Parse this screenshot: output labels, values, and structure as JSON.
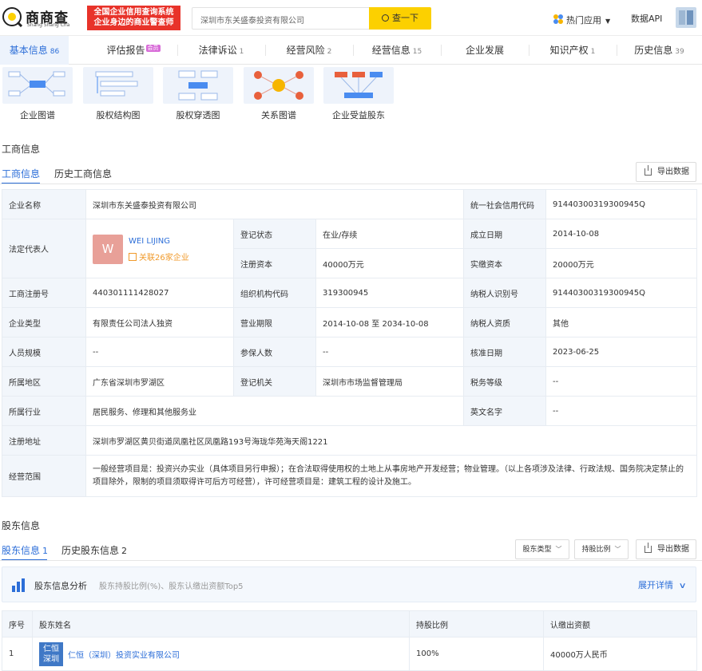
{
  "header": {
    "logo_text": "商商查",
    "logo_sub": "Shang Shang Cha",
    "promo_line1": "全国企业信用查询系统",
    "promo_line2": "企业身边的商业警查师",
    "search_value": "深圳市东关盛泰投资有限公司",
    "search_button": "查一下",
    "hot_apps": "热门应用",
    "data_api": "数据API"
  },
  "tabs": [
    {
      "label": "基本信息",
      "count": "86"
    },
    {
      "label": "评估报告",
      "badge": "会员"
    },
    {
      "label": "法律诉讼",
      "count": "1"
    },
    {
      "label": "经营风险",
      "count": "2"
    },
    {
      "label": "经营信息",
      "count": "15"
    },
    {
      "label": "企业发展",
      "count": ""
    },
    {
      "label": "知识产权",
      "count": "1"
    },
    {
      "label": "历史信息",
      "count": "39"
    }
  ],
  "graphs": [
    "企业图谱",
    "股权结构图",
    "股权穿透图",
    "关系图谱",
    "企业受益股东"
  ],
  "business": {
    "section_title": "工商信息",
    "subtab1": "工商信息",
    "subtab2": "历史工商信息",
    "export": "导出数据",
    "company_name_label": "企业名称",
    "company_name": "深圳市东关盛泰投资有限公司",
    "credit_code_label": "统一社会信用代码",
    "credit_code": "91440300319300945Q",
    "legal_rep_label": "法定代表人",
    "legal_rep_avatar": "W",
    "legal_rep_name": "WEI LIJING",
    "legal_rep_related": "关联26家企业",
    "reg_status_label": "登记状态",
    "reg_status": "在业/存续",
    "founded_label": "成立日期",
    "founded": "2014-10-08",
    "reg_capital_label": "注册资本",
    "reg_capital": "40000万元",
    "paid_capital_label": "实缴资本",
    "paid_capital": "20000万元",
    "reg_no_label": "工商注册号",
    "reg_no": "440301111428027",
    "org_code_label": "组织机构代码",
    "org_code": "319300945",
    "taxpayer_id_label": "纳税人识别号",
    "taxpayer_id": "91440300319300945Q",
    "company_type_label": "企业类型",
    "company_type": "有限责任公司法人独资",
    "term_label": "营业期限",
    "term": "2014-10-08 至 2034-10-08",
    "taxpayer_qual_label": "纳税人资质",
    "taxpayer_qual": "其他",
    "staff_label": "人员规模",
    "staff": "--",
    "insured_label": "参保人数",
    "insured": "--",
    "approve_label": "核准日期",
    "approve": "2023-06-25",
    "region_label": "所属地区",
    "region": "广东省深圳市罗湖区",
    "authority_label": "登记机关",
    "authority": "深圳市市场监督管理局",
    "tax_grade_label": "税务等级",
    "tax_grade": "--",
    "industry_label": "所属行业",
    "industry": "居民服务、修理和其他服务业",
    "en_name_label": "英文名字",
    "en_name": "--",
    "address_label": "注册地址",
    "address": "深圳市罗湖区黄贝街道凤凰社区凤凰路193号海珑华苑海天阁1221",
    "scope_label": "经营范围",
    "scope": "一般经营项目是：投资兴办实业（具体项目另行申报）；在合法取得使用权的土地上从事房地产开发经营；物业管理。（以上各项涉及法律、行政法规、国务院决定禁止的项目除外，限制的项目须取得许可后方可经营），许可经营项目是：建筑工程的设计及施工。"
  },
  "shareholders": {
    "section_title": "股东信息",
    "subtab1": "股东信息",
    "subtab1_count": "1",
    "subtab2": "历史股东信息",
    "subtab2_count": "2",
    "filter_type": "股东类型",
    "filter_ratio": "持股比例",
    "export": "导出数据",
    "analysis_title": "股东信息分析",
    "analysis_desc": "股东持股比例(%)、股东认缴出资额Top5",
    "analysis_more": "展开详情",
    "columns": [
      "序号",
      "股东姓名",
      "持股比例",
      "认缴出资额"
    ],
    "rows": [
      {
        "no": "1",
        "logo": "仁恒深圳",
        "name": "仁恒（深圳）投资实业有限公司",
        "ratio": "100%",
        "amount": "40000万人民币"
      }
    ]
  },
  "colors": {
    "accent": "#2c6ed8",
    "brand_yellow": "#fcd000",
    "promo_red": "#e8332a"
  }
}
